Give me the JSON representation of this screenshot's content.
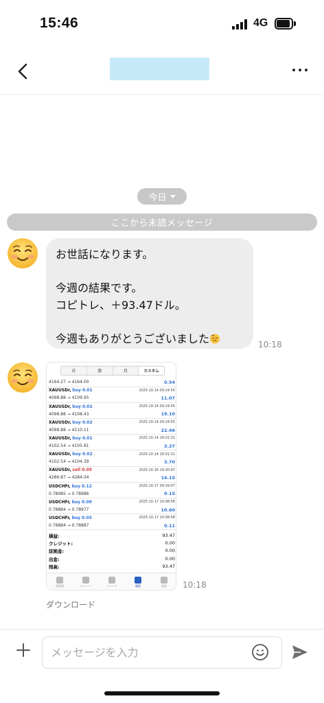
{
  "status_bar": {
    "time": "15:46",
    "network": "4G"
  },
  "header": {
    "title": "",
    "back_icon": "chevron-left-icon",
    "more_icon": "more-horizontal-icon"
  },
  "chat": {
    "date_label": "今日",
    "unread_divider": "ここから未読メッセージ",
    "messages": [
      {
        "type": "text",
        "avatar_icon": "smiling-face-emoji",
        "lines": [
          "お世話になります。",
          "",
          "今週の結果です。",
          "コピトレ、＋93.47ドル。",
          "",
          "今週もありがとうございました"
        ],
        "trailing_emoji": "pensive-face-emoji",
        "time": "10:18"
      },
      {
        "type": "image",
        "avatar_icon": "smiling-face-emoji",
        "time": "10:18",
        "download_label": "ダウンロード",
        "image": {
          "tabs": [
            "日",
            "週",
            "月",
            "カスタム"
          ],
          "active_tab": "カスタム",
          "first_row": {
            "prices": "4164.27 → 4164.00",
            "profit": "0.54"
          },
          "trades": [
            {
              "symbol": "XAUUSDr,",
              "side": "buy",
              "lots": "0.01",
              "datetime": "2025.10.14 09:24:55",
              "prices": "4098.88 → 4109.95",
              "profit": "11.07"
            },
            {
              "symbol": "XAUUSDr,",
              "side": "buy",
              "lots": "0.02",
              "datetime": "2025.10.14 09:24:55",
              "prices": "4098.88 → 4108.43",
              "profit": "19.10"
            },
            {
              "symbol": "XAUUSDr,",
              "side": "buy",
              "lots": "0.02",
              "datetime": "2025.10.14 09:24:55",
              "prices": "4098.88 → 4110.11",
              "profit": "22.46"
            },
            {
              "symbol": "XAUUSDr,",
              "side": "buy",
              "lots": "0.01",
              "datetime": "2025.10.14 16:01:31",
              "prices": "4102.54 → 4105.91",
              "profit": "3.37"
            },
            {
              "symbol": "XAUUSDr,",
              "side": "buy",
              "lots": "0.02",
              "datetime": "2025.10.14 16:01:31",
              "prices": "4102.54 → 4104.39",
              "profit": "3.70"
            },
            {
              "symbol": "XAUUSDr,",
              "side": "sell",
              "lots": "0.05",
              "datetime": "2025.10.16 19:30:47",
              "prices": "4286.87 → 4284.04",
              "profit": "14.15"
            },
            {
              "symbol": "USDCHFr,",
              "side": "buy",
              "lots": "0.12",
              "datetime": "2025.10.17 09:39:47",
              "prices": "0.78985 → 0.78986",
              "profit": "0.15"
            },
            {
              "symbol": "USDCHFr,",
              "side": "buy",
              "lots": "0.09",
              "datetime": "2025.10.17 10:08:58",
              "prices": "0.78884 → 0.78977",
              "profit": "10.60"
            },
            {
              "symbol": "USDCHFr,",
              "side": "buy",
              "lots": "0.03",
              "datetime": "2025.10.17 10:08:58",
              "prices": "0.78884 → 0.78887",
              "profit": "0.11"
            }
          ],
          "summary": [
            {
              "label": "損益:",
              "value": "93.47"
            },
            {
              "label": "クレジット:",
              "value": "0.00"
            },
            {
              "label": "証拠金:",
              "value": "0.00"
            },
            {
              "label": "出金:",
              "value": "0.00"
            },
            {
              "label": "残高:",
              "value": "93.47"
            }
          ],
          "bottom_tabs": [
            "気配値",
            "チャート",
            "トレード",
            "履歴",
            "設定"
          ],
          "active_bottom_tab": "履歴"
        }
      }
    ]
  },
  "composer": {
    "placeholder": "メッセージを入力",
    "value": ""
  },
  "colors": {
    "accent_blue": "#2b6fd6",
    "sell_red": "#d03b3b",
    "bubble_bg": "#ededed",
    "title_placeholder": "#c6e9f8"
  }
}
